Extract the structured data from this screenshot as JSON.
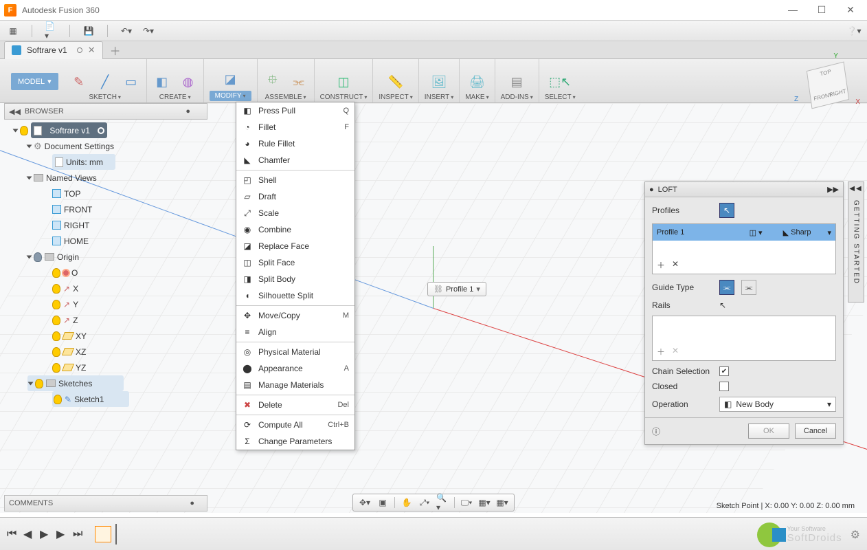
{
  "window": {
    "title": "Autodesk Fusion 360"
  },
  "document_tab": {
    "name": "Softrare v1"
  },
  "ribbon": {
    "model_button": "MODEL",
    "groups": {
      "sketch": "SKETCH",
      "create": "CREATE",
      "modify": "MODIFY",
      "assemble": "ASSEMBLE",
      "construct": "CONSTRUCT",
      "inspect": "INSPECT",
      "insert": "INSERT",
      "make": "MAKE",
      "addins": "ADD-INS",
      "select": "SELECT"
    }
  },
  "browser": {
    "title": "BROWSER",
    "root": "Softrare v1",
    "doc_settings": "Document Settings",
    "units": "Units: mm",
    "named_views": "Named Views",
    "views": {
      "top": "TOP",
      "front": "FRONT",
      "right": "RIGHT",
      "home": "HOME"
    },
    "origin": "Origin",
    "origin_items": {
      "o": "O",
      "x": "X",
      "y": "Y",
      "z": "Z",
      "xy": "XY",
      "xz": "XZ",
      "yz": "YZ"
    },
    "sketches": "Sketches",
    "sketch1": "Sketch1"
  },
  "modify_menu": {
    "press_pull": {
      "label": "Press Pull",
      "shortcut": "Q"
    },
    "fillet": {
      "label": "Fillet",
      "shortcut": "F"
    },
    "rule_fillet": {
      "label": "Rule Fillet"
    },
    "chamfer": {
      "label": "Chamfer"
    },
    "shell": {
      "label": "Shell"
    },
    "draft": {
      "label": "Draft"
    },
    "scale": {
      "label": "Scale"
    },
    "combine": {
      "label": "Combine"
    },
    "replace_face": {
      "label": "Replace Face"
    },
    "split_face": {
      "label": "Split Face"
    },
    "split_body": {
      "label": "Split Body"
    },
    "silhouette_split": {
      "label": "Silhouette Split"
    },
    "move_copy": {
      "label": "Move/Copy",
      "shortcut": "M"
    },
    "align": {
      "label": "Align"
    },
    "physical_material": {
      "label": "Physical Material"
    },
    "appearance": {
      "label": "Appearance",
      "shortcut": "A"
    },
    "manage_materials": {
      "label": "Manage Materials"
    },
    "delete": {
      "label": "Delete",
      "shortcut": "Del"
    },
    "compute_all": {
      "label": "Compute All",
      "shortcut": "Ctrl+B"
    },
    "change_parameters": {
      "label": "Change Parameters"
    }
  },
  "canvas": {
    "profile_label": "Profile 1"
  },
  "loft": {
    "title": "LOFT",
    "profiles_label": "Profiles",
    "profile1": "Profile 1",
    "profile1_mode": "Sharp",
    "guide_type_label": "Guide Type",
    "rails_label": "Rails",
    "chain_label": "Chain Selection",
    "closed_label": "Closed",
    "operation_label": "Operation",
    "operation_value": "New Body",
    "ok": "OK",
    "cancel": "Cancel"
  },
  "getting_started": "GETTING STARTED",
  "comments": {
    "title": "COMMENTS"
  },
  "status": "Sketch Point | X: 0.00 Y: 0.00 Z: 0.00 mm",
  "viewcube": {
    "top": "TOP",
    "front": "FRONT",
    "right": "RIGHT"
  },
  "brand": {
    "line1": "Your Software",
    "line2": "SoftDroids"
  }
}
